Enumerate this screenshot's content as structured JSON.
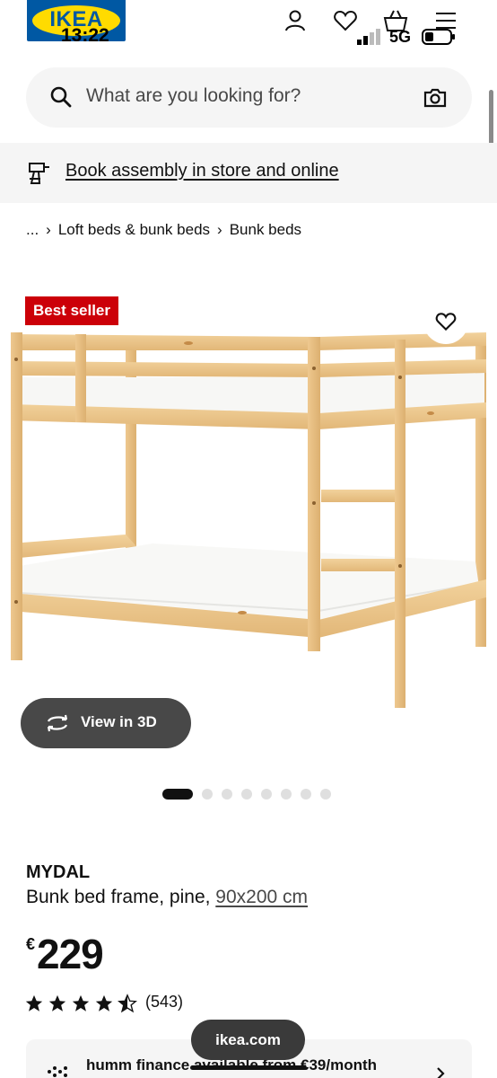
{
  "status_bar": {
    "time": "13:22",
    "network": "5G"
  },
  "header": {
    "logo_text": "IKEA",
    "icons": [
      "account-icon",
      "heart-icon",
      "shopping-bag-icon",
      "menu-icon"
    ]
  },
  "search": {
    "placeholder": "What are you looking for?"
  },
  "assembly_banner": {
    "link_label": "Book assembly in store and online"
  },
  "breadcrumb": {
    "items": [
      "...",
      "Loft beds & bunk beds",
      "Bunk beds"
    ]
  },
  "product_media": {
    "badge": "Best seller",
    "view_3d_label": "View in 3D",
    "image_count": 8,
    "active_image": 1
  },
  "product": {
    "name": "MYDAL",
    "description": "Bunk bed frame, pine, ",
    "size": "90x200 cm",
    "currency": "€",
    "price": "229",
    "rating": 4.5,
    "review_count": "(543)"
  },
  "finance": {
    "text": "humm finance available from €39/month"
  },
  "browser": {
    "url": "ikea.com"
  },
  "colors": {
    "brand_blue": "#0058a3",
    "brand_yellow": "#ffdb00",
    "badge_red": "#cc0008",
    "dark_button": "#484848",
    "surface_gray": "#f5f5f5"
  }
}
